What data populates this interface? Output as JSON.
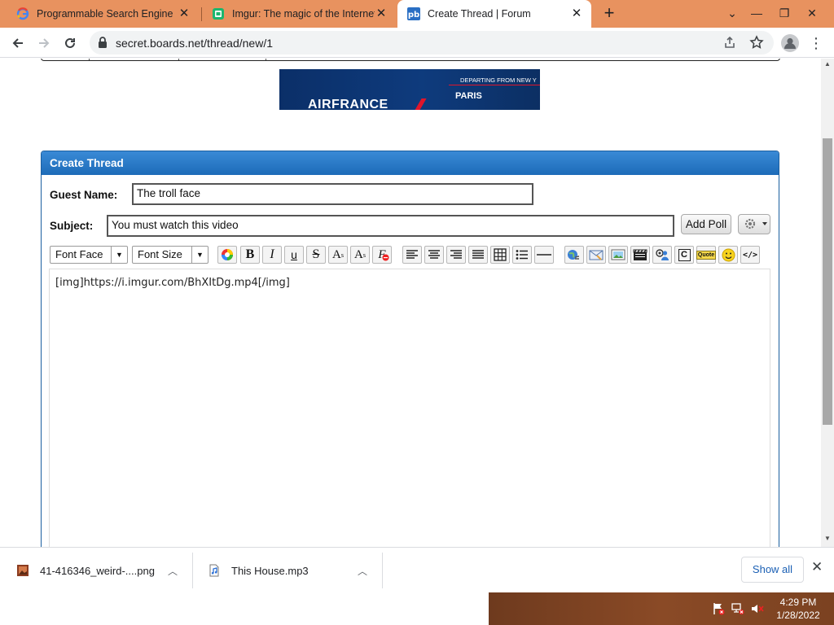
{
  "browser": {
    "tabs": [
      {
        "title": "Programmable Search Engine",
        "icon": "google-icon",
        "active": false
      },
      {
        "title": "Imgur: The magic of the Internet",
        "icon": "imgur-icon",
        "active": false
      },
      {
        "title": "Create Thread | Forum",
        "icon": "forum-icon",
        "active": true
      }
    ],
    "url": "secret.boards.net/thread/new/1",
    "accent_color": "#e8925f"
  },
  "ad": {
    "brand": "AIRFRANCE",
    "tagline": "DEPARTING FROM NEW Y",
    "city": "PARIS"
  },
  "form": {
    "panel_title": "Create Thread",
    "guest_name_label": "Guest Name:",
    "guest_name_value": "The troll face",
    "subject_label": "Subject:",
    "subject_value": "You must watch this video",
    "add_poll_label": "Add Poll",
    "font_face_label": "Font Face",
    "font_size_label": "Font Size",
    "editor_content": "[img]https://i.imgur.com/BhXItDg.mp4[/img]",
    "header_color": "#2a7bc9"
  },
  "toolbar_buttons": {
    "bold": "B",
    "italic": "I",
    "underline": "u",
    "strike": "S",
    "superscript": "A",
    "subscript": "A",
    "clear_format": "F",
    "code_c": "C",
    "quote": "Quote",
    "source": "</>"
  },
  "downloads": {
    "items": [
      {
        "name": "41-416346_weird-....png",
        "icon": "image-file-icon"
      },
      {
        "name": "This House.mp3",
        "icon": "audio-file-icon"
      }
    ],
    "show_all_label": "Show all"
  },
  "taskbar": {
    "time": "4:29 PM",
    "date": "1/28/2022"
  }
}
